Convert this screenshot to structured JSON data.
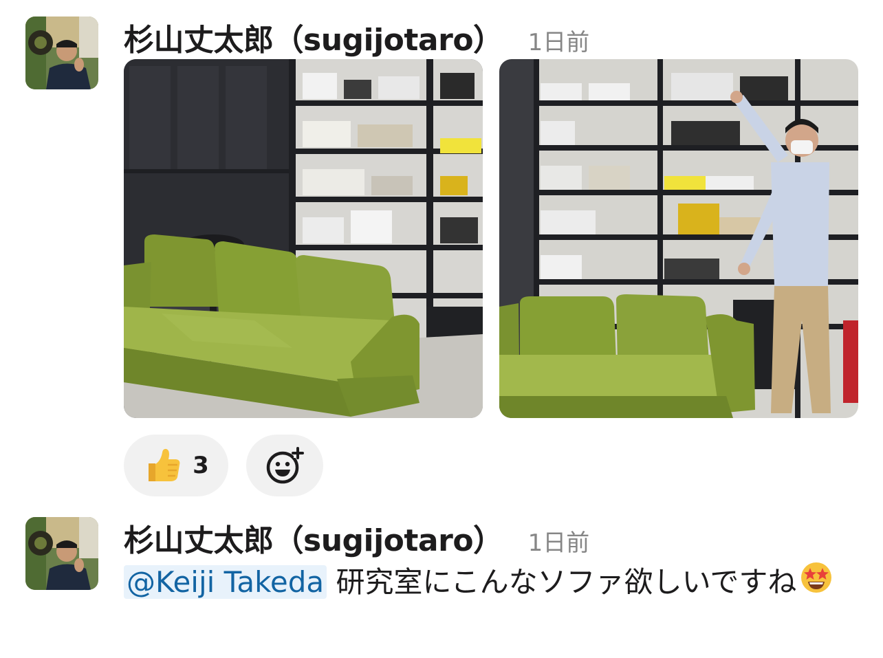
{
  "messages": [
    {
      "author": "杉山丈太郎（sugijotaro）",
      "timestamp": "1日前",
      "attachments": [
        {
          "name": "ar-sofa-photo-1"
        },
        {
          "name": "ar-sofa-photo-2"
        }
      ],
      "reactions": [
        {
          "emoji": "thumbs-up",
          "count": "3"
        },
        {
          "emoji": "add-reaction",
          "count": ""
        }
      ]
    },
    {
      "author": "杉山丈太郎（sugijotaro）",
      "timestamp": "1日前",
      "mention": "@Keiji Takeda",
      "text": " 研究室にこんなソファ欲しいですね",
      "emoji": "star-struck"
    }
  ],
  "colors": {
    "mention_bg": "#e8f2fb",
    "mention_text": "#1264a3",
    "timestamp": "#868686",
    "reaction_bg": "#f1f1f1",
    "sofa_green": "#8aa23a"
  }
}
